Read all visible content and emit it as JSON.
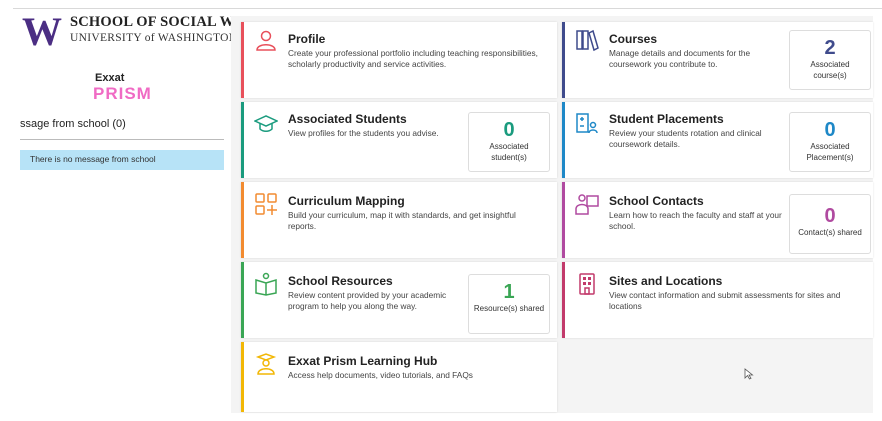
{
  "sidebar": {
    "logo_letter": "W",
    "school_name": "SCHOOL OF SOCIAL WORK",
    "university_name": "UNIVERSITY of WASHINGTON",
    "exxat_label": "Exxat",
    "prism_label": "PRISM",
    "message_title": "ssage from school (0)",
    "message_text": "There is no message from school"
  },
  "cards": {
    "profile": {
      "title": "Profile",
      "desc": "Create your professional portfolio including teaching responsibilities, scholarly productivity and service activities."
    },
    "courses": {
      "title": "Courses",
      "desc": "Manage details and documents for the coursework you contribute to.",
      "count": "2",
      "count_label": "Associated course(s)"
    },
    "associated_students": {
      "title": "Associated Students",
      "desc": "View profiles for the students you advise.",
      "count": "0",
      "count_label": "Associated student(s)"
    },
    "student_placements": {
      "title": "Student Placements",
      "desc": "Review your students rotation and clinical coursework details.",
      "count": "0",
      "count_label": "Associated Placement(s)"
    },
    "curriculum_mapping": {
      "title": "Curriculum Mapping",
      "desc": "Build your curriculum, map it with standards, and get insightful reports."
    },
    "school_contacts": {
      "title": "School Contacts",
      "desc": "Learn how to reach the faculty and staff at your school.",
      "count": "0",
      "count_label": "Contact(s) shared"
    },
    "school_resources": {
      "title": "School Resources",
      "desc": "Review content provided by your academic program to help you along the way.",
      "count": "1",
      "count_label": "Resource(s) shared"
    },
    "sites_locations": {
      "title": "Sites and Locations",
      "desc": "View contact information and submit assessments for sites and locations"
    },
    "learning_hub": {
      "title": "Exxat Prism Learning Hub",
      "desc": "Access help documents, video tutorials, and FAQs"
    }
  },
  "colors": {
    "uw_purple": "#4b2e83",
    "prism_pink": "#f06bc4",
    "profile": "#e8505b",
    "courses": "#3f4b8c",
    "students": "#1a9b7e",
    "placements": "#1e88c7",
    "curriculum": "#f28b30",
    "contacts": "#b04aa0",
    "resources": "#3aa655",
    "sites": "#c23a6b",
    "hub": "#f2b705"
  },
  "icons": {
    "profile": "person-icon",
    "courses": "books-icon",
    "students": "graduation-cap-icon",
    "placements": "placement-board-icon",
    "curriculum": "grid-plus-icon",
    "contacts": "presenter-icon",
    "resources": "open-book-person-icon",
    "sites": "building-icon",
    "hub": "graduate-icon"
  }
}
